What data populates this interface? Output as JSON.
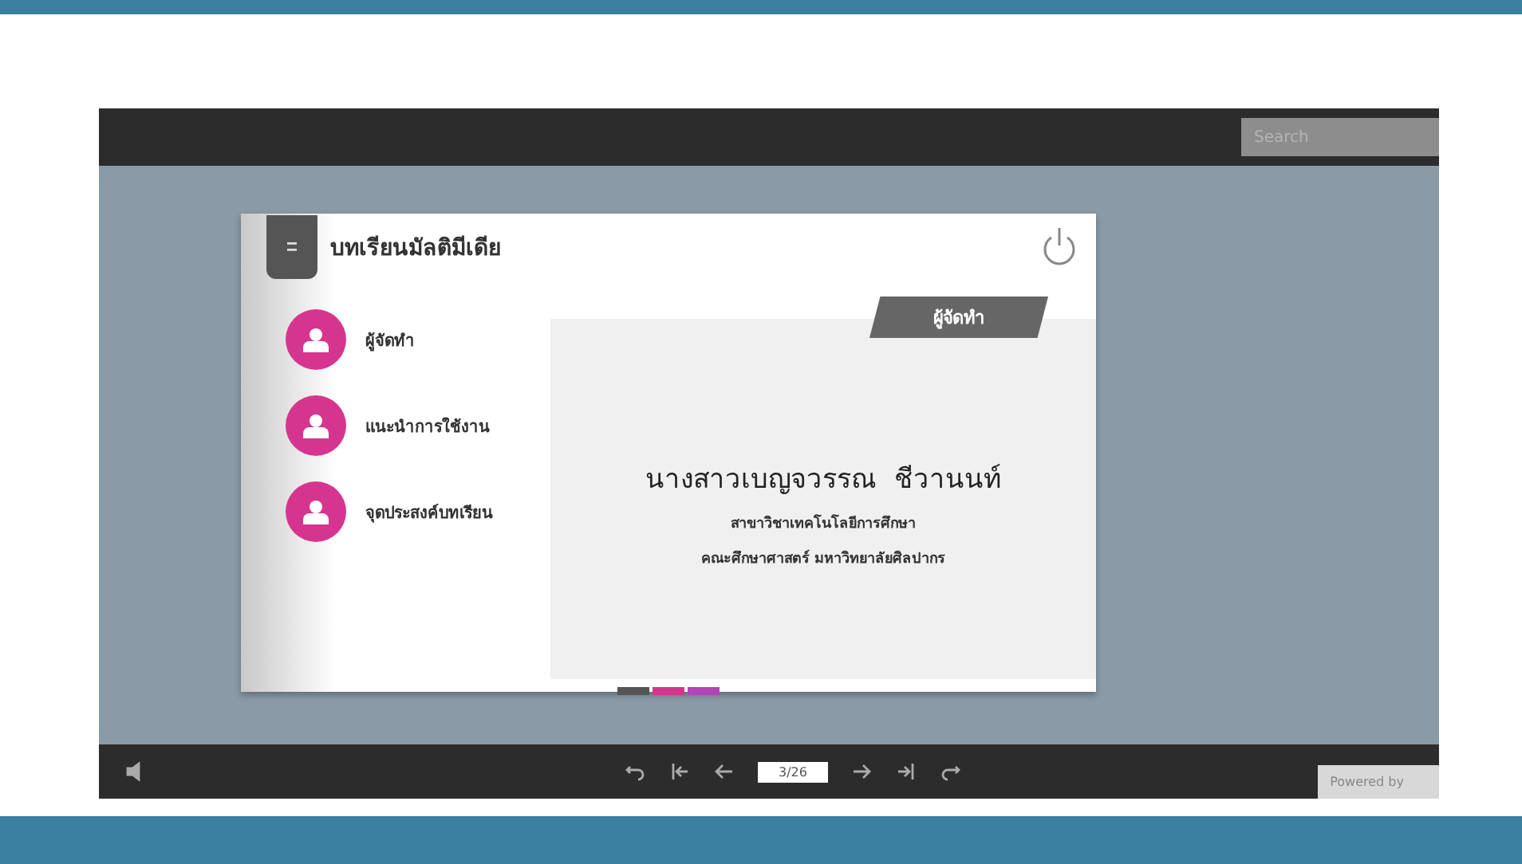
{
  "viewer": {
    "search": {
      "placeholder": "Search"
    },
    "page_counter": "3/26",
    "powered_by": "Powered by"
  },
  "book": {
    "title": "บทเรียนมัลติมีเดีย",
    "menu": [
      {
        "label": "ผู้จัดทำ"
      },
      {
        "label": "แนะนำการใช้งาน"
      },
      {
        "label": "จุดประสงค์บทเรียน"
      }
    ],
    "section_tag": "ผู้จัดทำ",
    "author": "นางสาวเบญจวรรณ  ชีวานนท์",
    "lines": [
      "สาขาวิชาเทคโนโลยีการศึกษา",
      "คณะศึกษาศาสตร์ มหาวิทยาลัยศิลปากร"
    ]
  }
}
